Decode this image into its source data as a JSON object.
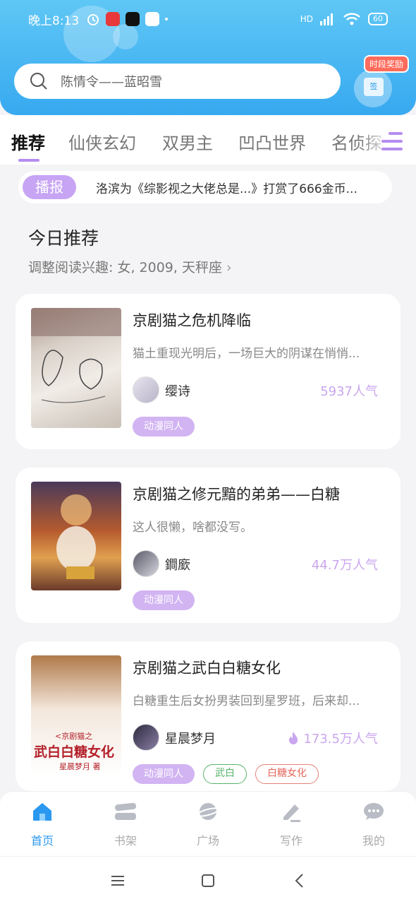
{
  "status_bar": {
    "time": "晚上8:13",
    "signal": "HD",
    "battery": "60"
  },
  "search": {
    "placeholder": "陈情令——蓝昭雪"
  },
  "reward": {
    "badge": "时段奖励",
    "sign_label": "签"
  },
  "tabs": [
    {
      "label": "推荐",
      "active": true
    },
    {
      "label": "仙侠玄幻"
    },
    {
      "label": "双男主"
    },
    {
      "label": "凹凸世界"
    },
    {
      "label": "名侦探"
    }
  ],
  "broadcast": {
    "label": "播报",
    "text": "洛滨为《综影视之大佬总是...》打赏了666金币..."
  },
  "section": {
    "title": "今日推荐",
    "subtitle": "调整阅读兴趣: 女, 2009, 天秤座"
  },
  "books": [
    {
      "title": "京剧猫之危机降临",
      "desc": "猫土重现光明后，一场巨大的阴谋在悄悄...",
      "author": "缨诗",
      "popularity": "5937人气",
      "tags": [
        {
          "label": "动漫同人",
          "style": "purple"
        }
      ]
    },
    {
      "title": "京剧猫之修元黯的弟弟——白糖",
      "desc": "这人很懒，啥都没写。",
      "author": "鐧廞",
      "popularity": "44.7万人气",
      "tags": [
        {
          "label": "动漫同人",
          "style": "purple"
        }
      ]
    },
    {
      "title": "京剧猫之武白白糖女化",
      "desc": "白糖重生后女扮男装回到星罗班，后来却...",
      "author": "星晨梦月",
      "popularity": "173.5万人气",
      "hot": true,
      "cover_text": {
        "line1": "<京剧猫之",
        "line2": "武白白糖女化",
        "line3": "星晨梦月 著"
      },
      "tags": [
        {
          "label": "动漫同人",
          "style": "purple"
        },
        {
          "label": "武白",
          "style": "green"
        },
        {
          "label": "白糖女化",
          "style": "red"
        }
      ]
    }
  ],
  "bottom_nav": [
    {
      "label": "首页",
      "icon": "home-icon",
      "active": true
    },
    {
      "label": "书架",
      "icon": "bookshelf-icon"
    },
    {
      "label": "广场",
      "icon": "planet-icon"
    },
    {
      "label": "写作",
      "icon": "pen-icon"
    },
    {
      "label": "我的",
      "icon": "chat-bubble-icon"
    }
  ],
  "colors": {
    "header": "#37a9f0",
    "accent": "#b68cf0",
    "nav_active": "#2b98f0"
  }
}
